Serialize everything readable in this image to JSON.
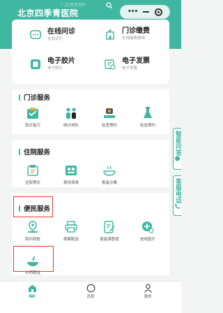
{
  "header": {
    "title": "北京四季青医院",
    "faint_text": "门诊患者预约",
    "capsule_more": "•••"
  },
  "quick": [
    {
      "title": "在线问诊",
      "sub": "在线诊疗",
      "icon": "chat-icon"
    },
    {
      "title": "门诊缴费",
      "sub": "在线缴费费用",
      "icon": "building-icon"
    },
    {
      "title": "电子胶片",
      "sub": "电子胶片",
      "icon": "film-icon"
    },
    {
      "title": "电子发票",
      "sub": "电子发票",
      "icon": "invoice-icon"
    }
  ],
  "sections": {
    "outpatient": {
      "title": "门诊服务",
      "items": [
        {
          "label": "就诊指引",
          "icon": "guide-icon"
        },
        {
          "label": "候诊排队",
          "icon": "queue-icon"
        },
        {
          "label": "检查预约",
          "icon": "exam-icon"
        },
        {
          "label": "检验预约",
          "icon": "flask-icon"
        }
      ]
    },
    "inpatient": {
      "title": "住院服务",
      "items": [
        {
          "label": "住院预交",
          "icon": "deposit-icon"
        },
        {
          "label": "费用清单",
          "icon": "bill-icon"
        },
        {
          "label": "患者点餐",
          "icon": "meal-icon"
        }
      ]
    },
    "convenience": {
      "title": "便民服务",
      "items": [
        {
          "label": "院内导航",
          "icon": "navigation-icon"
        },
        {
          "label": "病案配送",
          "icon": "printer-icon"
        },
        {
          "label": "患者满意度",
          "icon": "survey-icon"
        },
        {
          "label": "信用医疗",
          "icon": "credit-icon"
        },
        {
          "label": "中药配送",
          "icon": "herb-icon"
        }
      ]
    }
  },
  "float_tabs": {
    "ai_consult": "智能问答",
    "customer_service": "客服电话"
  },
  "tabbar": [
    {
      "label": "首页",
      "icon": "home-icon"
    },
    {
      "label": "消息",
      "icon": "message-icon"
    },
    {
      "label": "我的",
      "icon": "user-icon"
    }
  ],
  "colors": {
    "accent": "#3fb7a1",
    "highlight": "#e23a2e",
    "background": "#f3f4f4"
  }
}
